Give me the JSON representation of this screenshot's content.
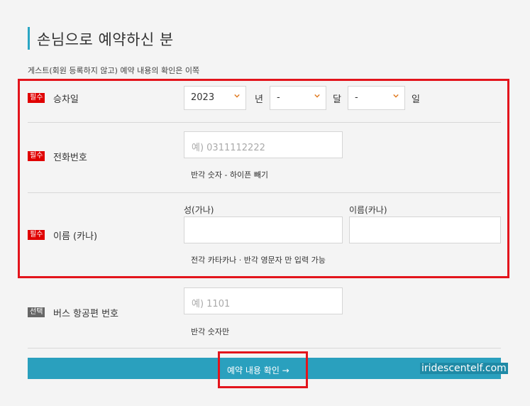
{
  "section": {
    "title": "손님으로 예약하신 분",
    "subtitle": "게스트(회원 등록하지 않고) 예약 내용의 확인은 이쪽"
  },
  "badges": {
    "required": "필수",
    "optional": "선택"
  },
  "boarding_date": {
    "label": "승차일",
    "year_value": "2023",
    "year_unit": "년",
    "month_value": "-",
    "month_unit": "달",
    "day_value": "-",
    "day_unit": "일"
  },
  "phone": {
    "label": "전화번호",
    "placeholder": "예) 0311112222",
    "hint": "반각 숫자 - 하이픈 빼기"
  },
  "name_kana": {
    "label": "이름 (카나)",
    "last_label": "성(가나)",
    "first_label": "이름(카나)",
    "hint": "전각 카타카나 · 반각 영문자 만 입력 가능"
  },
  "bus_number": {
    "label": "버스 항공편 번호",
    "placeholder": "예) 1101",
    "hint": "반각 숫자만"
  },
  "confirm": {
    "label": "예약 내용 확인 →"
  },
  "watermark": "iridescentelf.com",
  "colors": {
    "accent": "#2aa6c4",
    "required": "#e00000",
    "highlight": "#e3141c",
    "chevron": "#e07a1f"
  }
}
